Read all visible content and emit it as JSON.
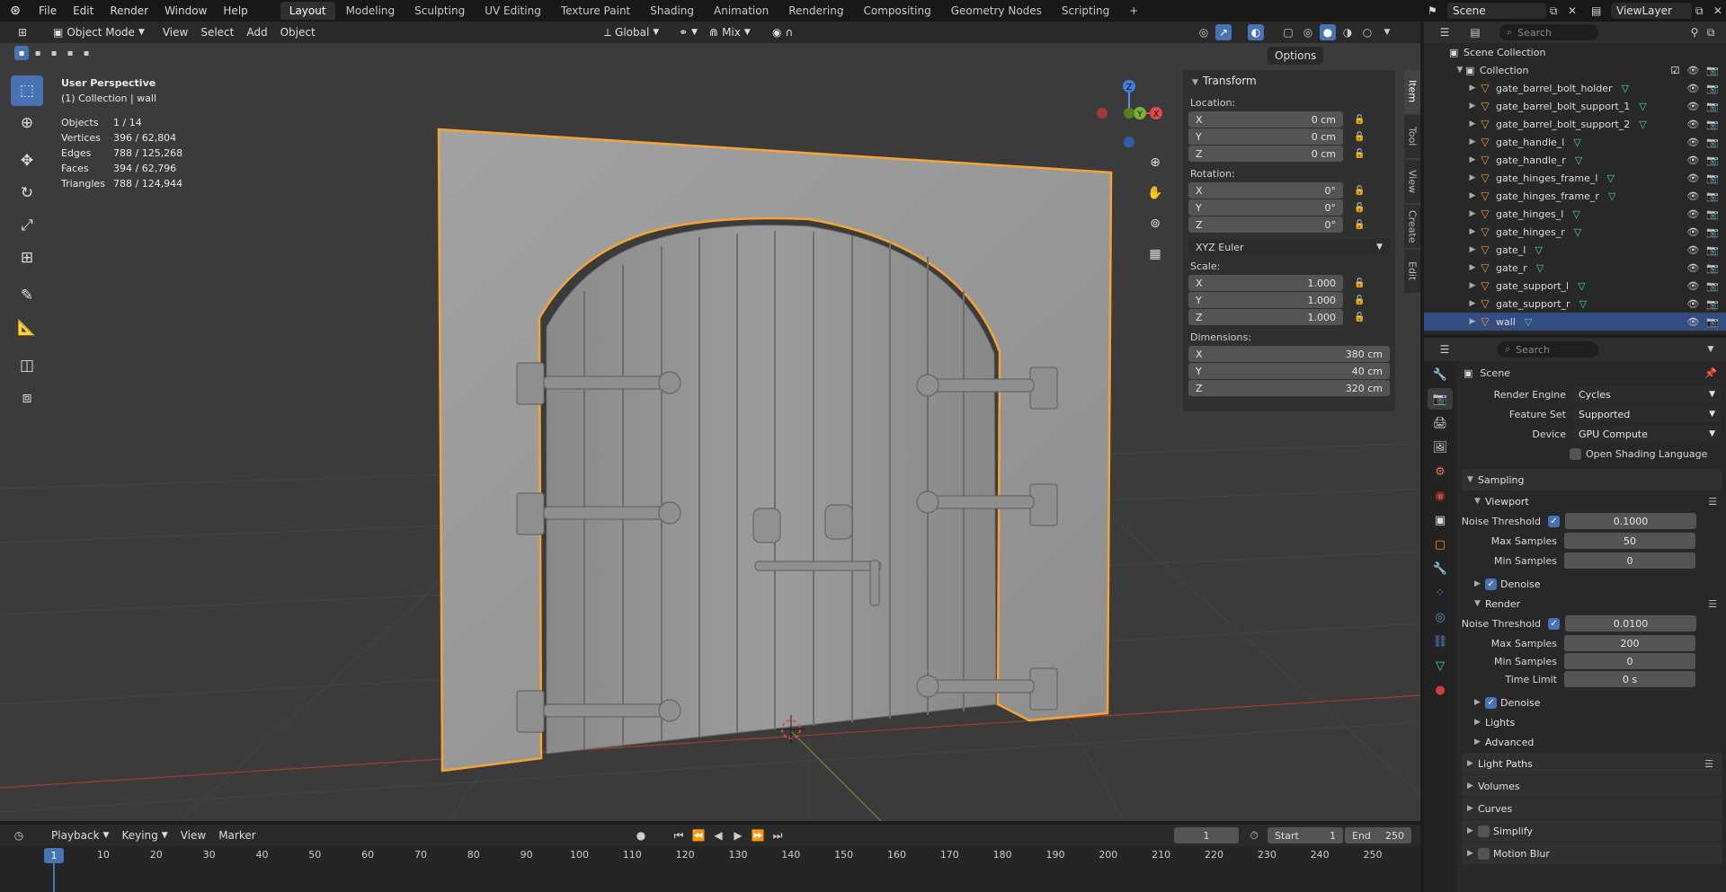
{
  "menubar": {
    "items": [
      "File",
      "Edit",
      "Render",
      "Window",
      "Help"
    ],
    "workspaces": [
      "Layout",
      "Modeling",
      "Sculpting",
      "UV Editing",
      "Texture Paint",
      "Shading",
      "Animation",
      "Rendering",
      "Compositing",
      "Geometry Nodes",
      "Scripting"
    ],
    "active_workspace": "Layout",
    "add_tab": "+",
    "scene": "Scene",
    "view_layer": "ViewLayer"
  },
  "viewport": {
    "mode": "Object Mode",
    "menus": [
      "View",
      "Select",
      "Add",
      "Object"
    ],
    "orientation": "Global",
    "snap_mode": "Mix",
    "options": "Options",
    "perspective": "User Perspective",
    "collection_info": "(1) Collection | wall",
    "stats": [
      {
        "label": "Objects",
        "value": "1 / 14"
      },
      {
        "label": "Vertices",
        "value": "396 / 62,804"
      },
      {
        "label": "Edges",
        "value": "788 / 125,268"
      },
      {
        "label": "Faces",
        "value": "394 / 62,796"
      },
      {
        "label": "Triangles",
        "value": "788 / 124,944"
      }
    ],
    "gizmo_labels": {
      "x": "X",
      "y": "Y",
      "z": "Z"
    }
  },
  "npanel": {
    "title": "Transform",
    "location_label": "Location:",
    "location": [
      {
        "axis": "X",
        "value": "0 cm"
      },
      {
        "axis": "Y",
        "value": "0 cm"
      },
      {
        "axis": "Z",
        "value": "0 cm"
      }
    ],
    "rotation_label": "Rotation:",
    "rotation": [
      {
        "axis": "X",
        "value": "0°"
      },
      {
        "axis": "Y",
        "value": "0°"
      },
      {
        "axis": "Z",
        "value": "0°"
      }
    ],
    "rotation_mode": "XYZ Euler",
    "scale_label": "Scale:",
    "scale": [
      {
        "axis": "X",
        "value": "1.000"
      },
      {
        "axis": "Y",
        "value": "1.000"
      },
      {
        "axis": "Z",
        "value": "1.000"
      }
    ],
    "dimensions_label": "Dimensions:",
    "dimensions": [
      {
        "axis": "X",
        "value": "380 cm"
      },
      {
        "axis": "Y",
        "value": "40 cm"
      },
      {
        "axis": "Z",
        "value": "320 cm"
      }
    ],
    "tabs": [
      "Item",
      "Tool",
      "View",
      "Create",
      "Edit"
    ]
  },
  "outliner": {
    "search_placeholder": "Search",
    "scene_collection": "Scene Collection",
    "collection": "Collection",
    "objects": [
      "gate_barrel_bolt_holder",
      "gate_barrel_bolt_support_1",
      "gate_barrel_bolt_support_2",
      "gate_handle_l",
      "gate_handle_r",
      "gate_hinges_frame_l",
      "gate_hinges_frame_r",
      "gate_hinges_l",
      "gate_hinges_r",
      "gate_l",
      "gate_r",
      "gate_support_l",
      "gate_support_r",
      "wall"
    ],
    "selected": "wall"
  },
  "properties": {
    "search_placeholder": "Search",
    "context": "Scene",
    "render_engine_label": "Render Engine",
    "render_engine": "Cycles",
    "feature_set_label": "Feature Set",
    "feature_set": "Supported",
    "device_label": "Device",
    "device": "GPU Compute",
    "osl_label": "Open Shading Language",
    "sampling": "Sampling",
    "viewport": "Viewport",
    "noise_threshold_label": "Noise Threshold",
    "vp_noise_threshold": "0.1000",
    "max_samples_label": "Max Samples",
    "vp_max_samples": "50",
    "min_samples_label": "Min Samples",
    "vp_min_samples": "0",
    "denoise": "Denoise",
    "render": "Render",
    "r_noise_threshold": "0.0100",
    "r_max_samples": "200",
    "r_min_samples": "0",
    "time_limit_label": "Time Limit",
    "r_time_limit": "0 s",
    "lights": "Lights",
    "advanced": "Advanced",
    "light_paths": "Light Paths",
    "volumes": "Volumes",
    "curves": "Curves",
    "simplify": "Simplify",
    "motion_blur": "Motion Blur"
  },
  "timeline": {
    "menus": [
      "Playback",
      "Keying",
      "View",
      "Marker"
    ],
    "current_frame": "1",
    "start_label": "Start",
    "start": "1",
    "end_label": "End",
    "end": "250",
    "ticks": [
      "1",
      "10",
      "20",
      "30",
      "40",
      "50",
      "60",
      "70",
      "80",
      "90",
      "100",
      "110",
      "120",
      "130",
      "140",
      "150",
      "160",
      "170",
      "180",
      "190",
      "200",
      "210",
      "220",
      "230",
      "240",
      "250"
    ]
  }
}
